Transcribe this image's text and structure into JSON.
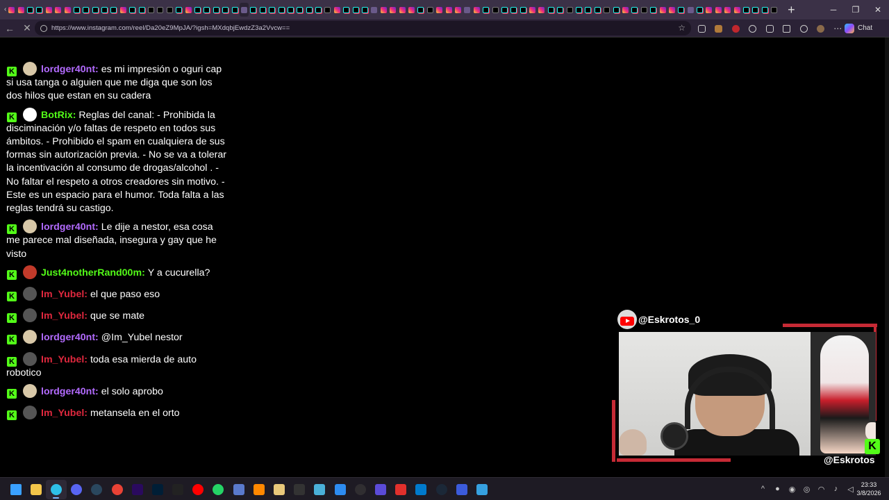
{
  "browser": {
    "url": "https://www.instagram.com/reel/Da20eZ9MpJA/?igsh=MXdqbjEwdzZ3a2Vvcw==",
    "chat_button_label": "Chat",
    "tab_favicons": [
      "instagram",
      "instagram",
      "tiktok",
      "tiktok",
      "instagram",
      "instagram",
      "instagram",
      "tiktok",
      "tiktok",
      "tiktok",
      "tiktok",
      "tiktok",
      "instagram",
      "tiktok",
      "tiktok",
      "x",
      "x",
      "x",
      "tiktok",
      "instagram",
      "tiktok",
      "tiktok",
      "tiktok",
      "tiktok",
      "tiktok",
      "other",
      "tiktok",
      "tiktok",
      "tiktok",
      "tiktok",
      "tiktok",
      "tiktok",
      "tiktok",
      "tiktok",
      "x",
      "instagram",
      "tiktok",
      "tiktok",
      "tiktok",
      "other",
      "instagram",
      "instagram",
      "instagram",
      "instagram",
      "tiktok",
      "x",
      "instagram",
      "instagram",
      "instagram",
      "other",
      "instagram",
      "tiktok",
      "x",
      "tiktok",
      "tiktok",
      "tiktok",
      "instagram",
      "instagram",
      "tiktok",
      "tiktok",
      "x",
      "tiktok",
      "tiktok",
      "tiktok",
      "x",
      "tiktok",
      "instagram",
      "tiktok",
      "x",
      "tiktok",
      "instagram",
      "instagram",
      "tiktok",
      "other",
      "tiktok",
      "instagram",
      "instagram",
      "instagram",
      "instagram",
      "tiktok",
      "tiktok",
      "tiktok",
      "x"
    ]
  },
  "chat": {
    "kick_badge": "K",
    "messages": [
      {
        "user": "lordger40nt",
        "color": "#b36bff",
        "avatar": "#d8c8a8",
        "text": "es mi impresión o oguri cap si usa tanga o alguien que me diga que son los dos hilos que estan en su cadera"
      },
      {
        "user": "BotRix",
        "color": "#53fc18",
        "avatar": "#ffffff",
        "text": "Reglas del canal: - Prohibida la disciminación y/o faltas de respeto en todos sus ámbitos. - Prohibido el spam en cualquiera de sus formas sin autorización previa. - No se va a tolerar la incentivación al consumo de drogas/alcohol . - No faltar el respeto a otros creadores sin motivo. - Este es un espacio para el humor. Toda falta a las reglas tendrá su castigo."
      },
      {
        "user": "lordger40nt",
        "color": "#b36bff",
        "avatar": "#d8c8a8",
        "text": "Le dije a nestor, esa cosa me parece mal diseñada, insegura y gay que he visto"
      },
      {
        "user": "Just4notherRand00m",
        "color": "#53fc18",
        "avatar": "#c23a2a",
        "text": "Y a cucurella?"
      },
      {
        "user": "Im_Yubel",
        "color": "#e0283e",
        "avatar": "#555555",
        "text": "el que paso eso"
      },
      {
        "user": "Im_Yubel",
        "color": "#e0283e",
        "avatar": "#555555",
        "text": "que se mate"
      },
      {
        "user": "lordger40nt",
        "color": "#b36bff",
        "avatar": "#d8c8a8",
        "text": "@Im_Yubel nestor"
      },
      {
        "user": "Im_Yubel",
        "color": "#e0283e",
        "avatar": "#555555",
        "text": "toda esa mierda de auto robotico"
      },
      {
        "user": "lordger40nt",
        "color": "#b36bff",
        "avatar": "#d8c8a8",
        "text": "el solo aprobo"
      },
      {
        "user": "Im_Yubel",
        "color": "#e0283e",
        "avatar": "#555555",
        "text": "metansela en el orto"
      }
    ]
  },
  "stream": {
    "youtube_handle": "@Eskrotos_0",
    "kick_handle": "@Eskrotos",
    "kick_logo": "K"
  },
  "taskbar": {
    "time": "23:33",
    "date": "3/8/2026",
    "apps": [
      "windows",
      "explorer",
      "edge",
      "discord",
      "steam",
      "chrome",
      "premiere",
      "photoshop",
      "capcut",
      "youtube",
      "whatsapp",
      "app",
      "vlc",
      "box",
      "ch",
      "image",
      "notes",
      "obs",
      "chip",
      "acrobat",
      "vscode",
      "steam2",
      "app2",
      "azure"
    ]
  }
}
